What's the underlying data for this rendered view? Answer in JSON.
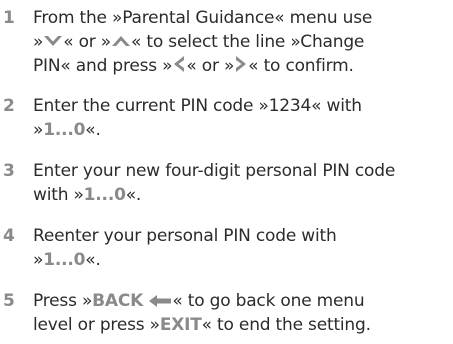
{
  "steps": [
    {
      "number": "1",
      "line1": {
        "p1": "From the »Parental Guidance« menu use"
      },
      "line2": {
        "p1": "»",
        "p2": "« or »",
        "p3": "« to select the line »Change"
      },
      "line3": {
        "p1": "PIN« and press »",
        "p2": "« or »",
        "p3": "« to confirm."
      },
      "icons": [
        "down-arrow-icon",
        "up-arrow-icon",
        "left-arrow-icon",
        "right-arrow-icon"
      ]
    },
    {
      "number": "2",
      "line1": {
        "p1": "Enter the current PIN code »1234« with"
      },
      "line2": {
        "p1": "»",
        "key": "1...0",
        "p2": "«."
      }
    },
    {
      "number": "3",
      "line1": {
        "p1": "Enter your new four-digit personal PIN code"
      },
      "line2": {
        "p1": "with »",
        "key": "1...0",
        "p2": "«."
      }
    },
    {
      "number": "4",
      "line1": {
        "p1": "Reenter your personal PIN code with"
      },
      "line2": {
        "p1": "»",
        "key": "1...0",
        "p2": "«."
      }
    },
    {
      "number": "5",
      "line1": {
        "p1": "Press »",
        "key": "BACK",
        "p2": "« to go back one menu"
      },
      "line2": {
        "p1": "level or press »",
        "key": "EXIT",
        "p2": "« to end the setting."
      },
      "icons": [
        "back-arrow-icon"
      ]
    }
  ],
  "colors": {
    "text": "#2b2b2b",
    "accent_grey": "#8a8a8a"
  }
}
